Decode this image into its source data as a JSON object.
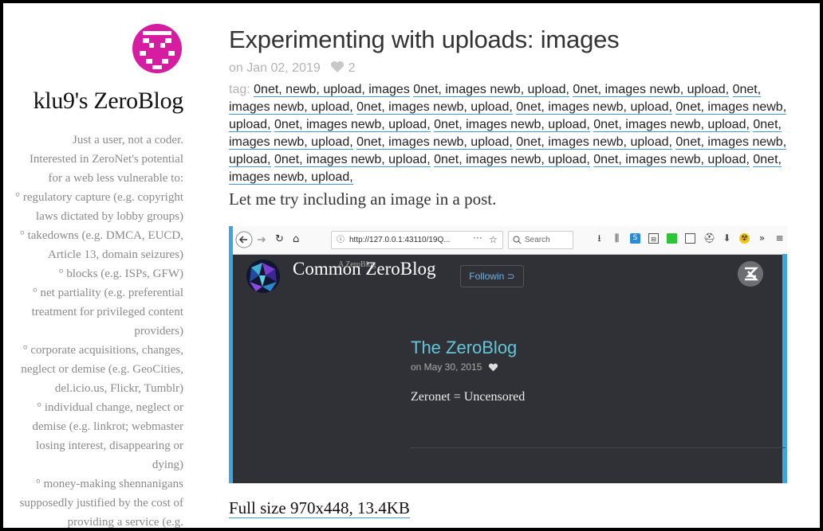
{
  "sidebar": {
    "blog_title": "klu9's ZeroBlog",
    "description_lines": [
      "Just a user, not a coder.",
      "Interested in ZeroNet's potential",
      "for a web less vulnerable to:",
      "° regulatory capture (e.g. copyright",
      "laws dictated by lobby groups)",
      "° takedowns (e.g. DMCA, EUCD,",
      "Article 13, domain seizures)",
      "° blocks (e.g. ISPs, GFW)",
      "° net partiality (e.g. preferential",
      "treatment for privileged content",
      "providers)",
      "° corporate acquisitions, changes,",
      "neglect or demise (e.g. GeoCities,",
      "del.icio.us, Flickr, Tumblr)",
      "° individual change, neglect or",
      "demise (e.g. linkrot; webmaster",
      "losing interest, disappearing or",
      "dying)",
      "° money-making shennanigans",
      "supposedly justified by the cost of",
      "providing a service (e.g."
    ]
  },
  "post": {
    "title": "Experimenting with uploads: images",
    "date": "on Jan 02, 2019",
    "likes": "2",
    "tag_label": "tag:",
    "tags": [
      "0net, newb, upload, images",
      "0net, images newb, upload,",
      "0net, images newb, upload,",
      "0net, images newb, upload,",
      "0net, images newb, upload,",
      "0net, images newb, upload,",
      "0net, images newb, upload,",
      "0net, images newb, upload,",
      "0net, images newb, upload,",
      "0net, images newb, upload,",
      "0net, images newb, upload,",
      "0net, images newb, upload,",
      "0net, images newb, upload,",
      "0net, images newb, upload,",
      "0net, images newb, upload,",
      "0net, images newb, upload,",
      "0net, images newb, upload,",
      "0net, images newb, upload,"
    ],
    "body": "Let me try including an image in a post.",
    "image_caption": "Full size 970x448, 13.4KB"
  },
  "screenshot": {
    "url": "http://127.0.0.1:43110/19Q...",
    "search_placeholder": "Search",
    "site_title": "Common ZeroBlog",
    "site_subtitle": "A ZeroBlog",
    "follow_label": "Followin",
    "post_title": "The ZeroBlog",
    "post_date": "on May 30, 2015",
    "post_body": "Zeronet = Uncensored"
  }
}
